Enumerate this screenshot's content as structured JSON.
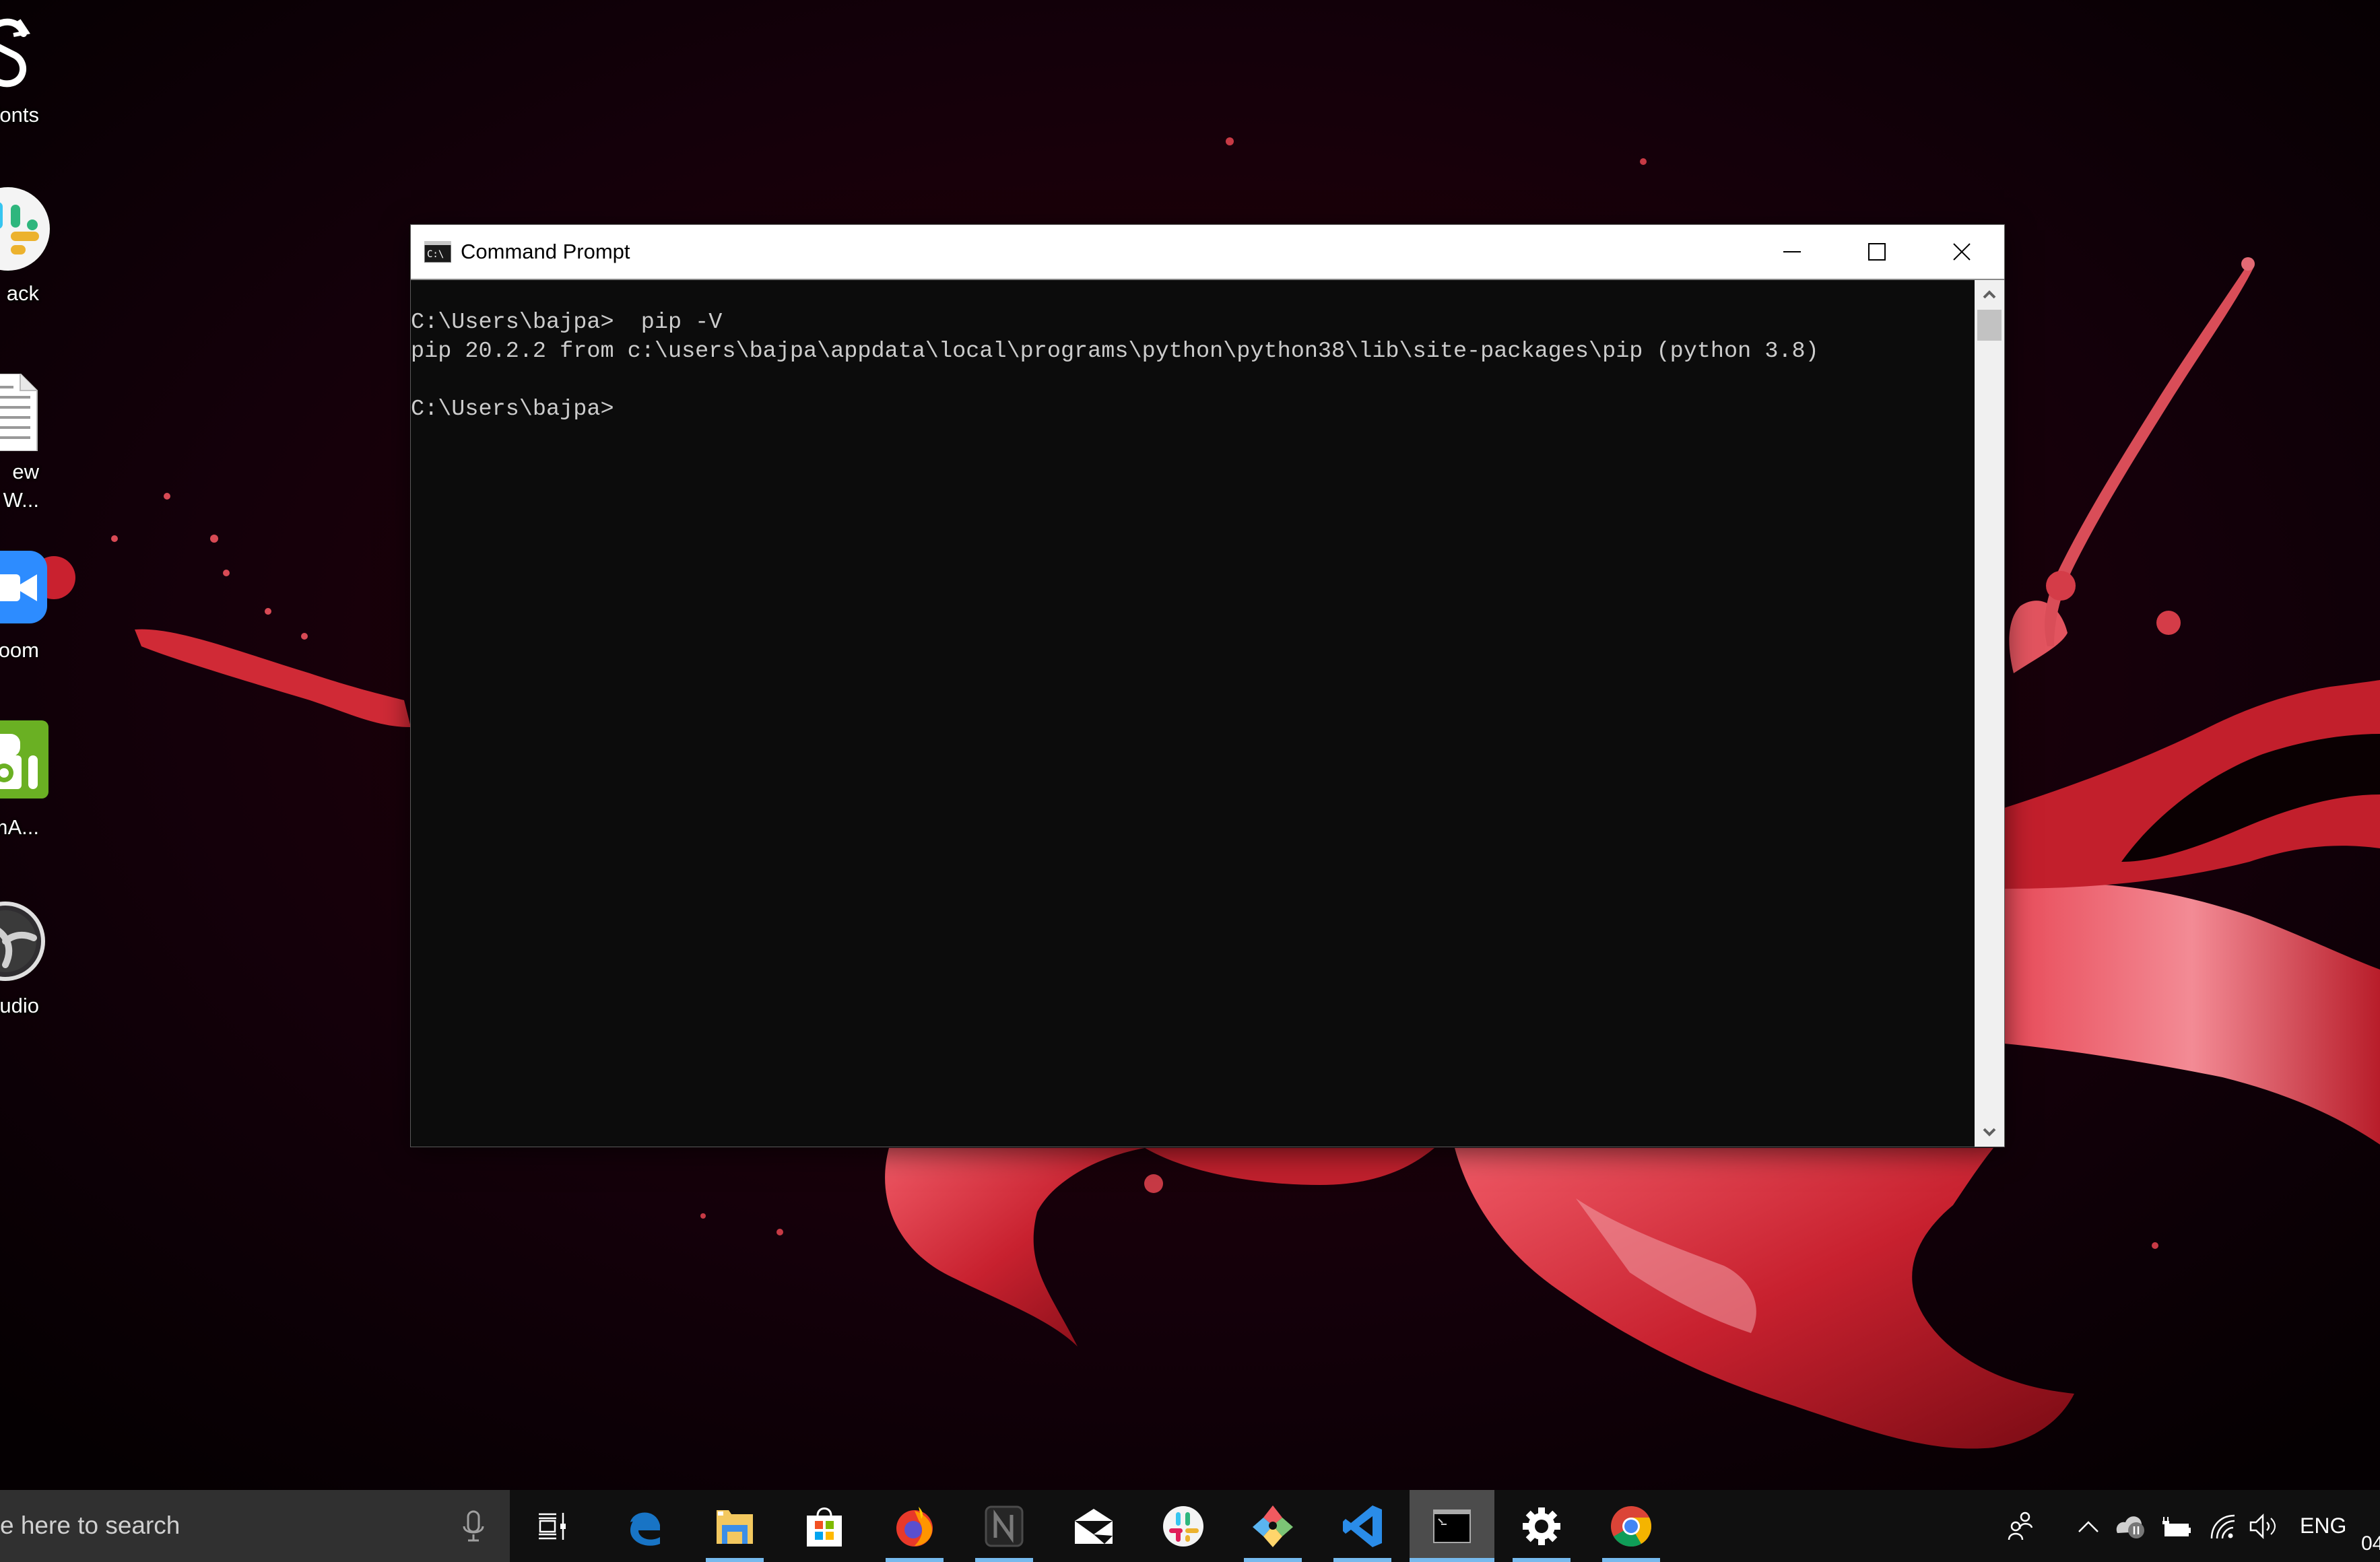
{
  "desktop": {
    "icons": [
      {
        "label_lines": [
          "Fonts"
        ],
        "icon": "fonts-shortcut-icon"
      },
      {
        "label_lines": [
          "ack"
        ],
        "icon": "slack-icon"
      },
      {
        "label_lines": [
          "ew",
          "soft W..."
        ],
        "icon": "word-document-icon"
      },
      {
        "label_lines": [
          "oom"
        ],
        "icon": "zoom-icon"
      },
      {
        "label_lines": [
          "CamA..."
        ],
        "icon": "droidcam-icon"
      },
      {
        "label_lines": [
          "Studio"
        ],
        "icon": "obs-studio-icon"
      }
    ]
  },
  "window": {
    "title": "Command Prompt",
    "controls": {
      "minimize": "minimize-icon",
      "maximize": "maximize-icon",
      "close": "close-icon"
    }
  },
  "console": {
    "lines": [
      "C:\\Users\\bajpa>  pip -V",
      "pip 20.2.2 from c:\\users\\bajpa\\appdata\\local\\programs\\python\\python38\\lib\\site-packages\\pip (python 3.8)",
      "",
      "C:\\Users\\bajpa>"
    ]
  },
  "taskbar": {
    "search_placeholder": "e here to search",
    "apps": [
      {
        "name": "task-view",
        "running": false,
        "active": false
      },
      {
        "name": "edge",
        "running": false,
        "active": false
      },
      {
        "name": "file-explorer",
        "running": true,
        "active": false
      },
      {
        "name": "microsoft-store",
        "running": false,
        "active": false
      },
      {
        "name": "firefox",
        "running": true,
        "active": false
      },
      {
        "name": "notion",
        "running": true,
        "active": false
      },
      {
        "name": "mail",
        "running": false,
        "active": false
      },
      {
        "name": "slack",
        "running": false,
        "active": false
      },
      {
        "name": "git-kraken",
        "running": true,
        "active": false
      },
      {
        "name": "vscode",
        "running": true,
        "active": false
      },
      {
        "name": "command-prompt",
        "running": true,
        "active": true
      },
      {
        "name": "settings",
        "running": true,
        "active": false
      },
      {
        "name": "chrome",
        "running": true,
        "active": false
      }
    ],
    "tray": {
      "language": "ENG",
      "clock_partial": "04"
    }
  },
  "colors": {
    "console_bg": "#0c0c0c",
    "console_fg": "#cccccc",
    "taskbar_bg": "#101010",
    "search_bg": "#303030",
    "running_indicator": "#76b9ed",
    "wallpaper_red": "#d42a35"
  }
}
